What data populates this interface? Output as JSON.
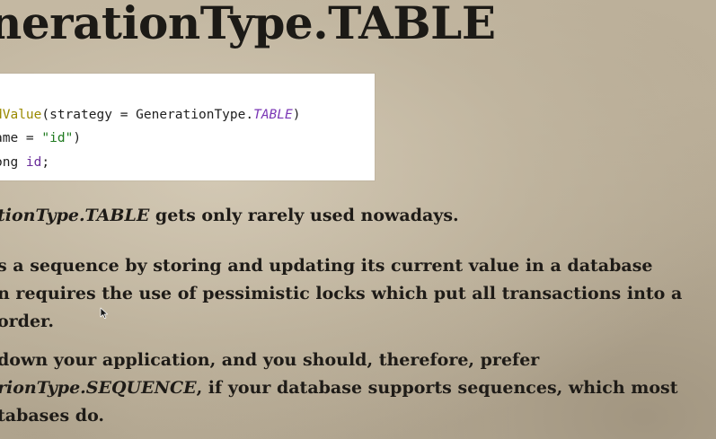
{
  "slide": {
    "title": "nerationType.TABLE"
  },
  "code": {
    "line1": {
      "annotation": "dValue",
      "open": "(strategy = GenerationType.",
      "constant": "TABLE",
      "close": ")"
    },
    "line2": {
      "prefix": "ame = ",
      "string": "\"id\"",
      "close": ")"
    },
    "line3": {
      "prefix": "ong ",
      "field": "id",
      "end": ";"
    }
  },
  "bullets": {
    "b1": {
      "italic": "tionType.TABLE",
      "text": " gets only rarely used nowadays."
    },
    "b2": {
      "line1": "s a sequence by storing and updating its current value in a database",
      "line2": "n requires the use of pessimistic locks which put all transactions into a",
      "line3": "order."
    },
    "b3": {
      "line1": "down your application, and you should, therefore, prefer",
      "line2_italic": "rionType.SEQUENCE",
      "line2_text": ", if your database supports sequences, which most",
      "line3": "tabases do."
    }
  },
  "colors": {
    "annotation": "#9a8a00",
    "constant": "#7a36b5",
    "string": "#1f7a1f",
    "field": "#6a2e9a"
  }
}
